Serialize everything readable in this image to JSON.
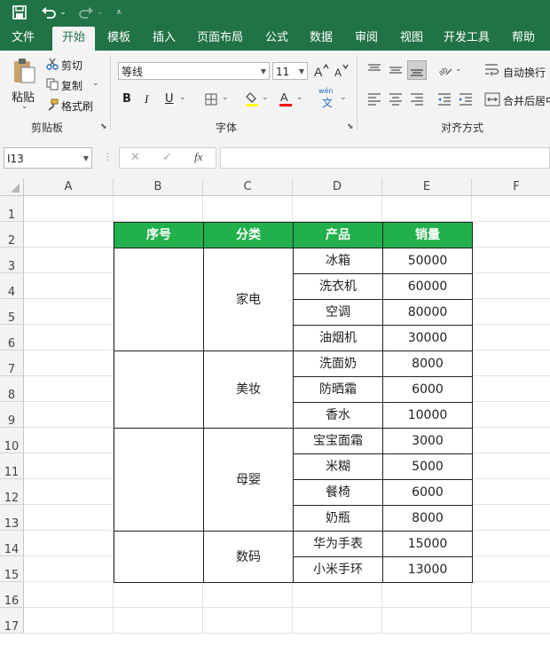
{
  "quick_access": {
    "save_icon": "save-icon",
    "undo_icon": "undo-icon",
    "redo_icon": "redo-icon",
    "customize_icon": "customize-icon"
  },
  "tabs": [
    {
      "label": "文件"
    },
    {
      "label": "开始"
    },
    {
      "label": "模板"
    },
    {
      "label": "插入"
    },
    {
      "label": "页面布局"
    },
    {
      "label": "公式"
    },
    {
      "label": "数据"
    },
    {
      "label": "审阅"
    },
    {
      "label": "视图"
    },
    {
      "label": "开发工具"
    },
    {
      "label": "帮助"
    }
  ],
  "ribbon": {
    "clipboard": {
      "paste": "粘贴",
      "cut": "剪切",
      "copy": "复制",
      "format_painter": "格式刷",
      "group_label": "剪贴板"
    },
    "font": {
      "font_name": "等线",
      "font_size": "11",
      "group_label": "字体",
      "bold": "B",
      "italic": "I",
      "underline": "U",
      "font_color_letter": "A",
      "wen_top": "wén",
      "wen_char": "文"
    },
    "alignment": {
      "wrap_text": "自动换行",
      "merge_center": "合并后居中",
      "group_label": "对齐方式"
    },
    "colors": {
      "fill": "#ffff00",
      "font": "#ff0000"
    }
  },
  "formula_bar": {
    "name_box": "I13",
    "cancel": "✕",
    "confirm": "✓",
    "fx": "fx",
    "formula": ""
  },
  "columns": [
    "A",
    "B",
    "C",
    "D",
    "E",
    "F"
  ],
  "rows": [
    "1",
    "2",
    "3",
    "4",
    "5",
    "6",
    "7",
    "8",
    "9",
    "10",
    "11",
    "12",
    "13",
    "14",
    "15",
    "16",
    "17"
  ],
  "table": {
    "headers": [
      "序号",
      "分类",
      "产品",
      "销量"
    ],
    "header_color": "#21b04b",
    "groups": [
      {
        "category": "家电",
        "items": [
          {
            "product": "冰箱",
            "sales": "50000"
          },
          {
            "product": "洗衣机",
            "sales": "60000"
          },
          {
            "product": "空调",
            "sales": "80000"
          },
          {
            "product": "油烟机",
            "sales": "30000"
          }
        ]
      },
      {
        "category": "美妆",
        "items": [
          {
            "product": "洗面奶",
            "sales": "8000"
          },
          {
            "product": "防晒霜",
            "sales": "6000"
          },
          {
            "product": "香水",
            "sales": "10000"
          }
        ]
      },
      {
        "category": "母婴",
        "items": [
          {
            "product": "宝宝面霜",
            "sales": "3000"
          },
          {
            "product": "米糊",
            "sales": "5000"
          },
          {
            "product": "餐椅",
            "sales": "6000"
          },
          {
            "product": "奶瓶",
            "sales": "8000"
          }
        ]
      },
      {
        "category": "数码",
        "items": [
          {
            "product": "华为手表",
            "sales": "15000"
          },
          {
            "product": "小米手环",
            "sales": "13000"
          }
        ]
      }
    ]
  }
}
